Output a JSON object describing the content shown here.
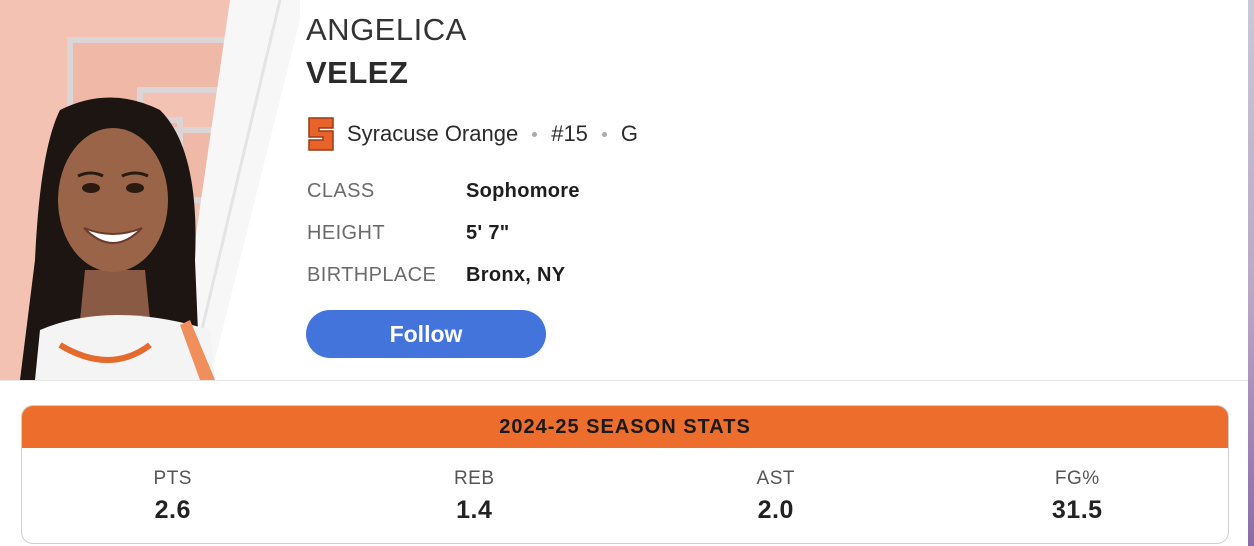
{
  "player": {
    "first_name": "ANGELICA",
    "last_name": "VELEZ",
    "team": "Syracuse Orange",
    "number": "#15",
    "position": "G",
    "photo_icon": "player-headshot"
  },
  "details": [
    {
      "label": "CLASS",
      "value": "Sophomore"
    },
    {
      "label": "HEIGHT",
      "value": "5' 7\""
    },
    {
      "label": "BIRTHPLACE",
      "value": "Bronx, NY"
    }
  ],
  "follow_label": "Follow",
  "stats": {
    "title": "2024-25 SEASON STATS",
    "items": [
      {
        "label": "PTS",
        "value": "2.6"
      },
      {
        "label": "REB",
        "value": "1.4"
      },
      {
        "label": "AST",
        "value": "2.0"
      },
      {
        "label": "FG%",
        "value": "31.5"
      }
    ]
  },
  "colors": {
    "team_orange": "#ec6d2c",
    "follow_blue": "#4274dc",
    "logo_bg": "#f3c2b2"
  }
}
